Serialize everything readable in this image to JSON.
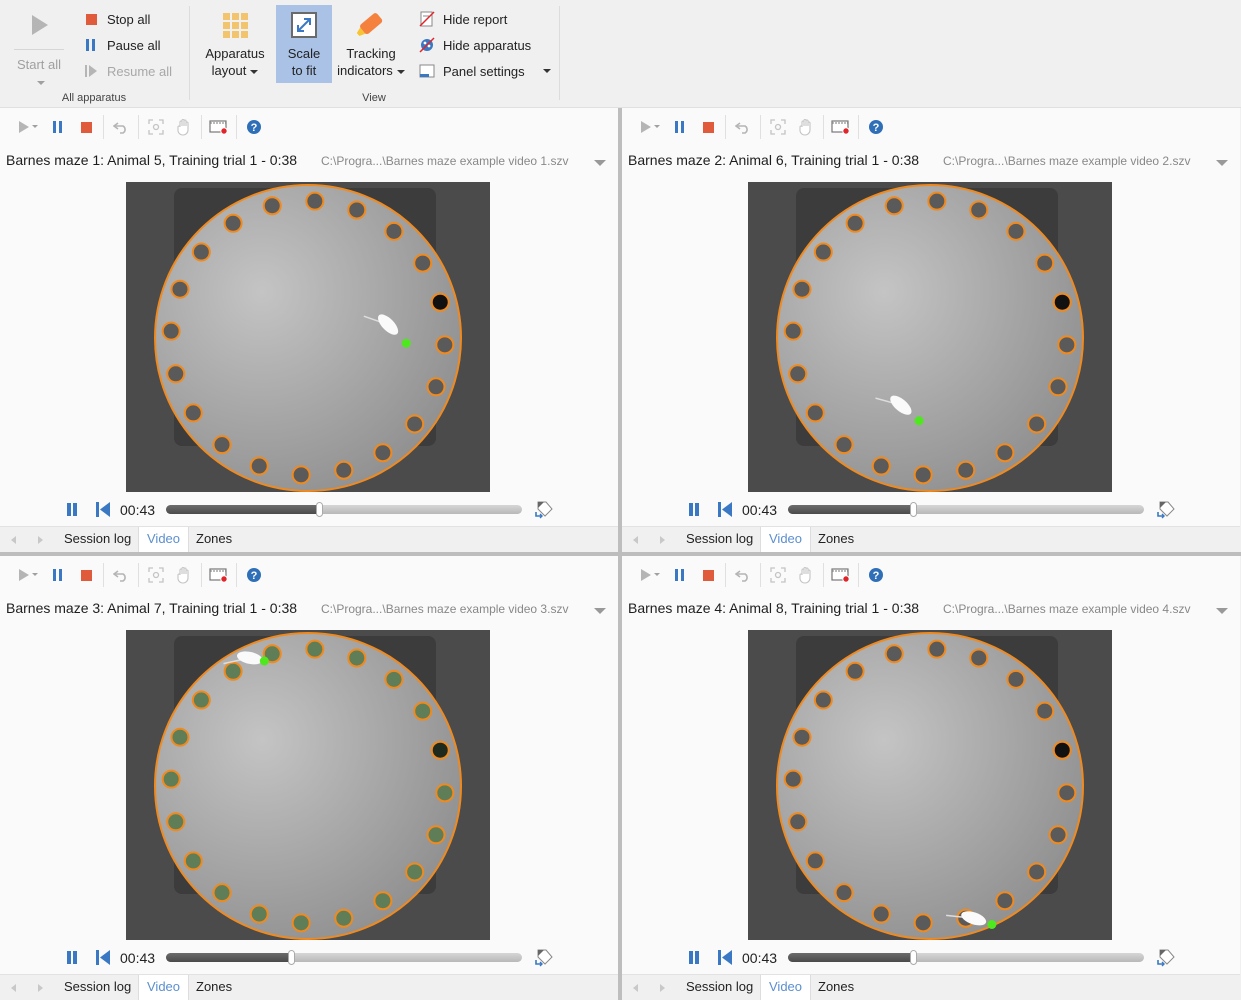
{
  "ribbon": {
    "all_apparatus": {
      "start_all": "Start all",
      "stop_all": "Stop all",
      "pause_all": "Pause all",
      "resume_all": "Resume all",
      "group_label": "All apparatus"
    },
    "view": {
      "apparatus_layout": [
        "Apparatus",
        "layout"
      ],
      "scale_to_fit": [
        "Scale",
        "to fit"
      ],
      "tracking_indicators": [
        "Tracking",
        "indicators"
      ],
      "hide_report": "Hide report",
      "hide_apparatus": "Hide apparatus",
      "panel_settings": "Panel settings",
      "group_label": "View"
    },
    "colors": {
      "stop": "#e05a3c",
      "accent_blue": "#3a78c3",
      "active_bg": "#a9c2e6",
      "layout_icon": "#f2c46e",
      "tracking_icon": "#f5813f"
    }
  },
  "panels": [
    {
      "title": "Barnes maze 1: Animal 5, Training trial 1 - 0:38",
      "path": "C:\\Progra...\\Barnes maze example video 1.szv",
      "time": "00:43",
      "progress": 0.43,
      "holes_style": "grey",
      "animal": {
        "body_x": 0.72,
        "body_y": 0.46,
        "nose_x": 0.77,
        "nose_y": 0.52,
        "tail_angle": 210
      },
      "tabs": [
        "Session log",
        "Video",
        "Zones"
      ],
      "active_tab": "Video"
    },
    {
      "title": "Barnes maze 2: Animal 6, Training trial 1 - 0:38",
      "path": "C:\\Progra...\\Barnes maze example video 2.szv",
      "time": "00:43",
      "progress": 0.35,
      "holes_style": "grey",
      "animal": {
        "body_x": 0.42,
        "body_y": 0.72,
        "nose_x": 0.47,
        "nose_y": 0.77,
        "tail_angle": 205
      },
      "tabs": [
        "Session log",
        "Video",
        "Zones"
      ],
      "active_tab": "Video"
    },
    {
      "title": "Barnes maze 3: Animal 7, Training trial 1 - 0:38",
      "path": "C:\\Progra...\\Barnes maze example video 3.szv",
      "time": "00:43",
      "progress": 0.35,
      "holes_style": "green",
      "animal": {
        "body_x": 0.34,
        "body_y": 0.09,
        "nose_x": 0.38,
        "nose_y": 0.1,
        "tail_angle": 160
      },
      "tabs": [
        "Session log",
        "Video",
        "Zones"
      ],
      "active_tab": "Video"
    },
    {
      "title": "Barnes maze 4: Animal 8, Training trial 1 - 0:38",
      "path": "C:\\Progra...\\Barnes maze example video 4.szv",
      "time": "00:43",
      "progress": 0.35,
      "holes_style": "grey",
      "animal": {
        "body_x": 0.62,
        "body_y": 0.93,
        "nose_x": 0.67,
        "nose_y": 0.95,
        "tail_angle": 190
      },
      "tabs": [
        "Session log",
        "Video",
        "Zones"
      ],
      "active_tab": "Video"
    }
  ],
  "maze": {
    "hole_count": 20,
    "escape_hole_index": 4,
    "ring_color": "#f08a1e",
    "tracked_point_color": "#4ee81f"
  }
}
